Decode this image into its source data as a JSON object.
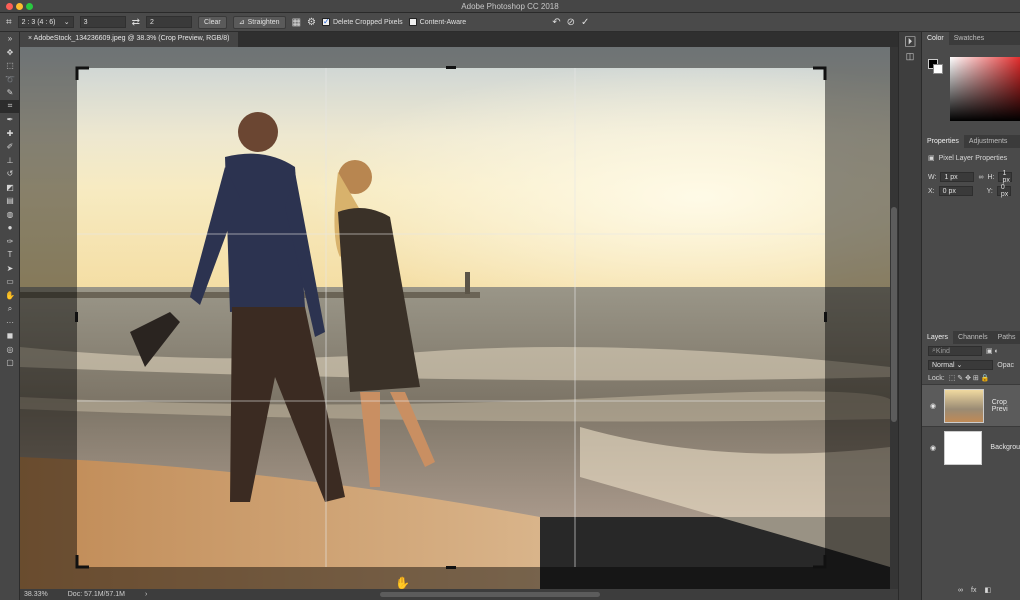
{
  "window": {
    "title": "Adobe Photoshop CC 2018"
  },
  "options_bar": {
    "ratio": "2 : 3 (4 : 6)",
    "width_value": "3",
    "height_value": "2",
    "clear_label": "Clear",
    "straighten_label": "Straighten",
    "delete_cropped_label": "Delete Cropped Pixels",
    "content_aware_label": "Content-Aware",
    "delete_cropped_checked": true,
    "content_aware_checked": false
  },
  "document": {
    "tab_label": "AdobeStock_134236609.jpeg @ 38.3% (Crop Preview, RGB/8)"
  },
  "status_bar": {
    "zoom": "38.33%",
    "doc": "Doc: 57.1M/57.1M",
    "arrow": "›"
  },
  "panels": {
    "color_tabs": [
      "Color",
      "Swatches"
    ],
    "properties_tabs": [
      "Properties",
      "Adjustments"
    ],
    "properties_title": "Pixel Layer Properties",
    "w_label": "W:",
    "w_value": "1 px",
    "h_label": "H:",
    "h_value": "1 px",
    "x_label": "X:",
    "x_value": "0 px",
    "y_label": "Y:",
    "y_value": "0 px",
    "layers_tabs": [
      "Layers",
      "Channels",
      "Paths"
    ],
    "kind_placeholder": "Kind",
    "blend_mode": "Normal",
    "opacity_label": "Opac",
    "lock_label": "Lock:",
    "layers": [
      {
        "name": "Crop Previ",
        "selected": true
      },
      {
        "name": "Backgrou",
        "selected": false
      }
    ]
  },
  "colors": {
    "accent": "#1d5fd6",
    "traffic_red": "#fc5f57",
    "traffic_yellow": "#fdbc2e",
    "traffic_green": "#28c840"
  }
}
